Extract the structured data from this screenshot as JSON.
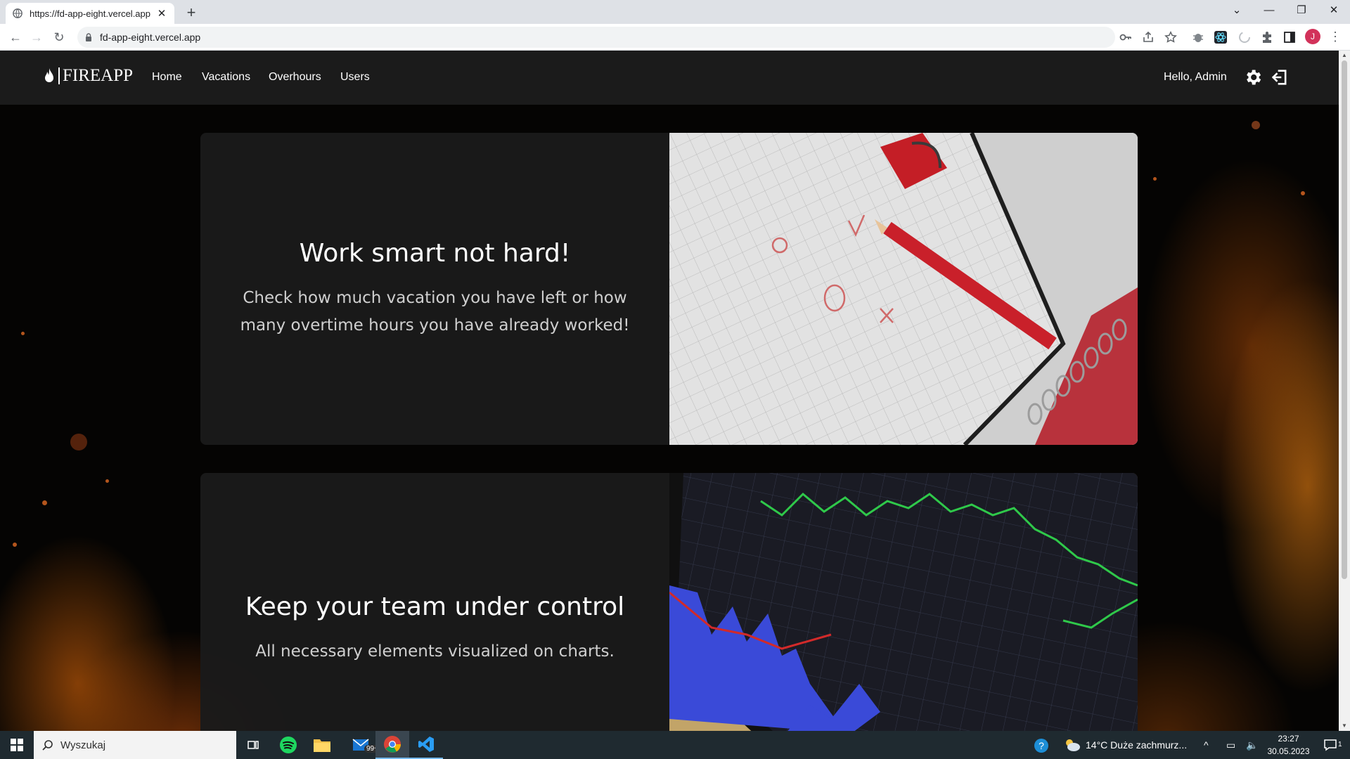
{
  "browser": {
    "tab_title": "https://fd-app-eight.vercel.app",
    "new_tab": "+",
    "url": "fd-app-eight.vercel.app",
    "profile_initial": "J"
  },
  "app": {
    "brand": "FIREAPP",
    "nav": [
      "Home",
      "Vacations",
      "Overhours",
      "Users"
    ],
    "greeting": "Hello, Admin"
  },
  "cards": [
    {
      "title": "Work smart not hard!",
      "text": "Check how much vacation you have left or how many overtime hours you have already worked!",
      "image": "notebook-pencil-image"
    },
    {
      "title": "Keep your team under control",
      "text": "All necessary elements visualized on charts.",
      "image": "stock-chart-tablet-image"
    }
  ],
  "taskbar": {
    "search_placeholder": "Wyszukaj",
    "mail_badge": "99+",
    "weather": "14°C  Duże zachmurz...",
    "time": "23:27",
    "date": "30.05.2023",
    "notifications": "1"
  }
}
